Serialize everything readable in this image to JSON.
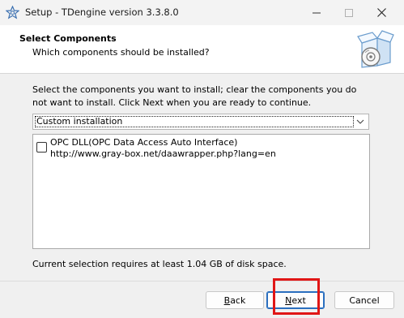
{
  "window": {
    "title": "Setup - TDengine version 3.3.8.0",
    "controls": [
      "minimize",
      "maximize",
      "close"
    ],
    "icon": "gear-star-icon"
  },
  "header": {
    "title": "Select Components",
    "subtitle": "Which components should be installed?",
    "icon": "install-box-disc-icon"
  },
  "main": {
    "instructions": "Select the components you want to install; clear the components you do not want to install. Click Next when you are ready to continue.",
    "install_type": {
      "selected": "Custom installation"
    },
    "components": [
      {
        "checked": false,
        "name": "OPC DLL(OPC Data Access Auto Interface)",
        "url": "http://www.gray-box.net/daawrapper.php?lang=en"
      }
    ],
    "disk_space": "Current selection requires at least 1.04 GB of disk space."
  },
  "footer": {
    "back": {
      "pre": "",
      "key": "B",
      "post": "ack"
    },
    "next": {
      "pre": "",
      "key": "N",
      "post": "ext"
    },
    "cancel": "Cancel"
  },
  "colors": {
    "highlight": "#e01616",
    "default_button_border": "#2a6fbf"
  }
}
